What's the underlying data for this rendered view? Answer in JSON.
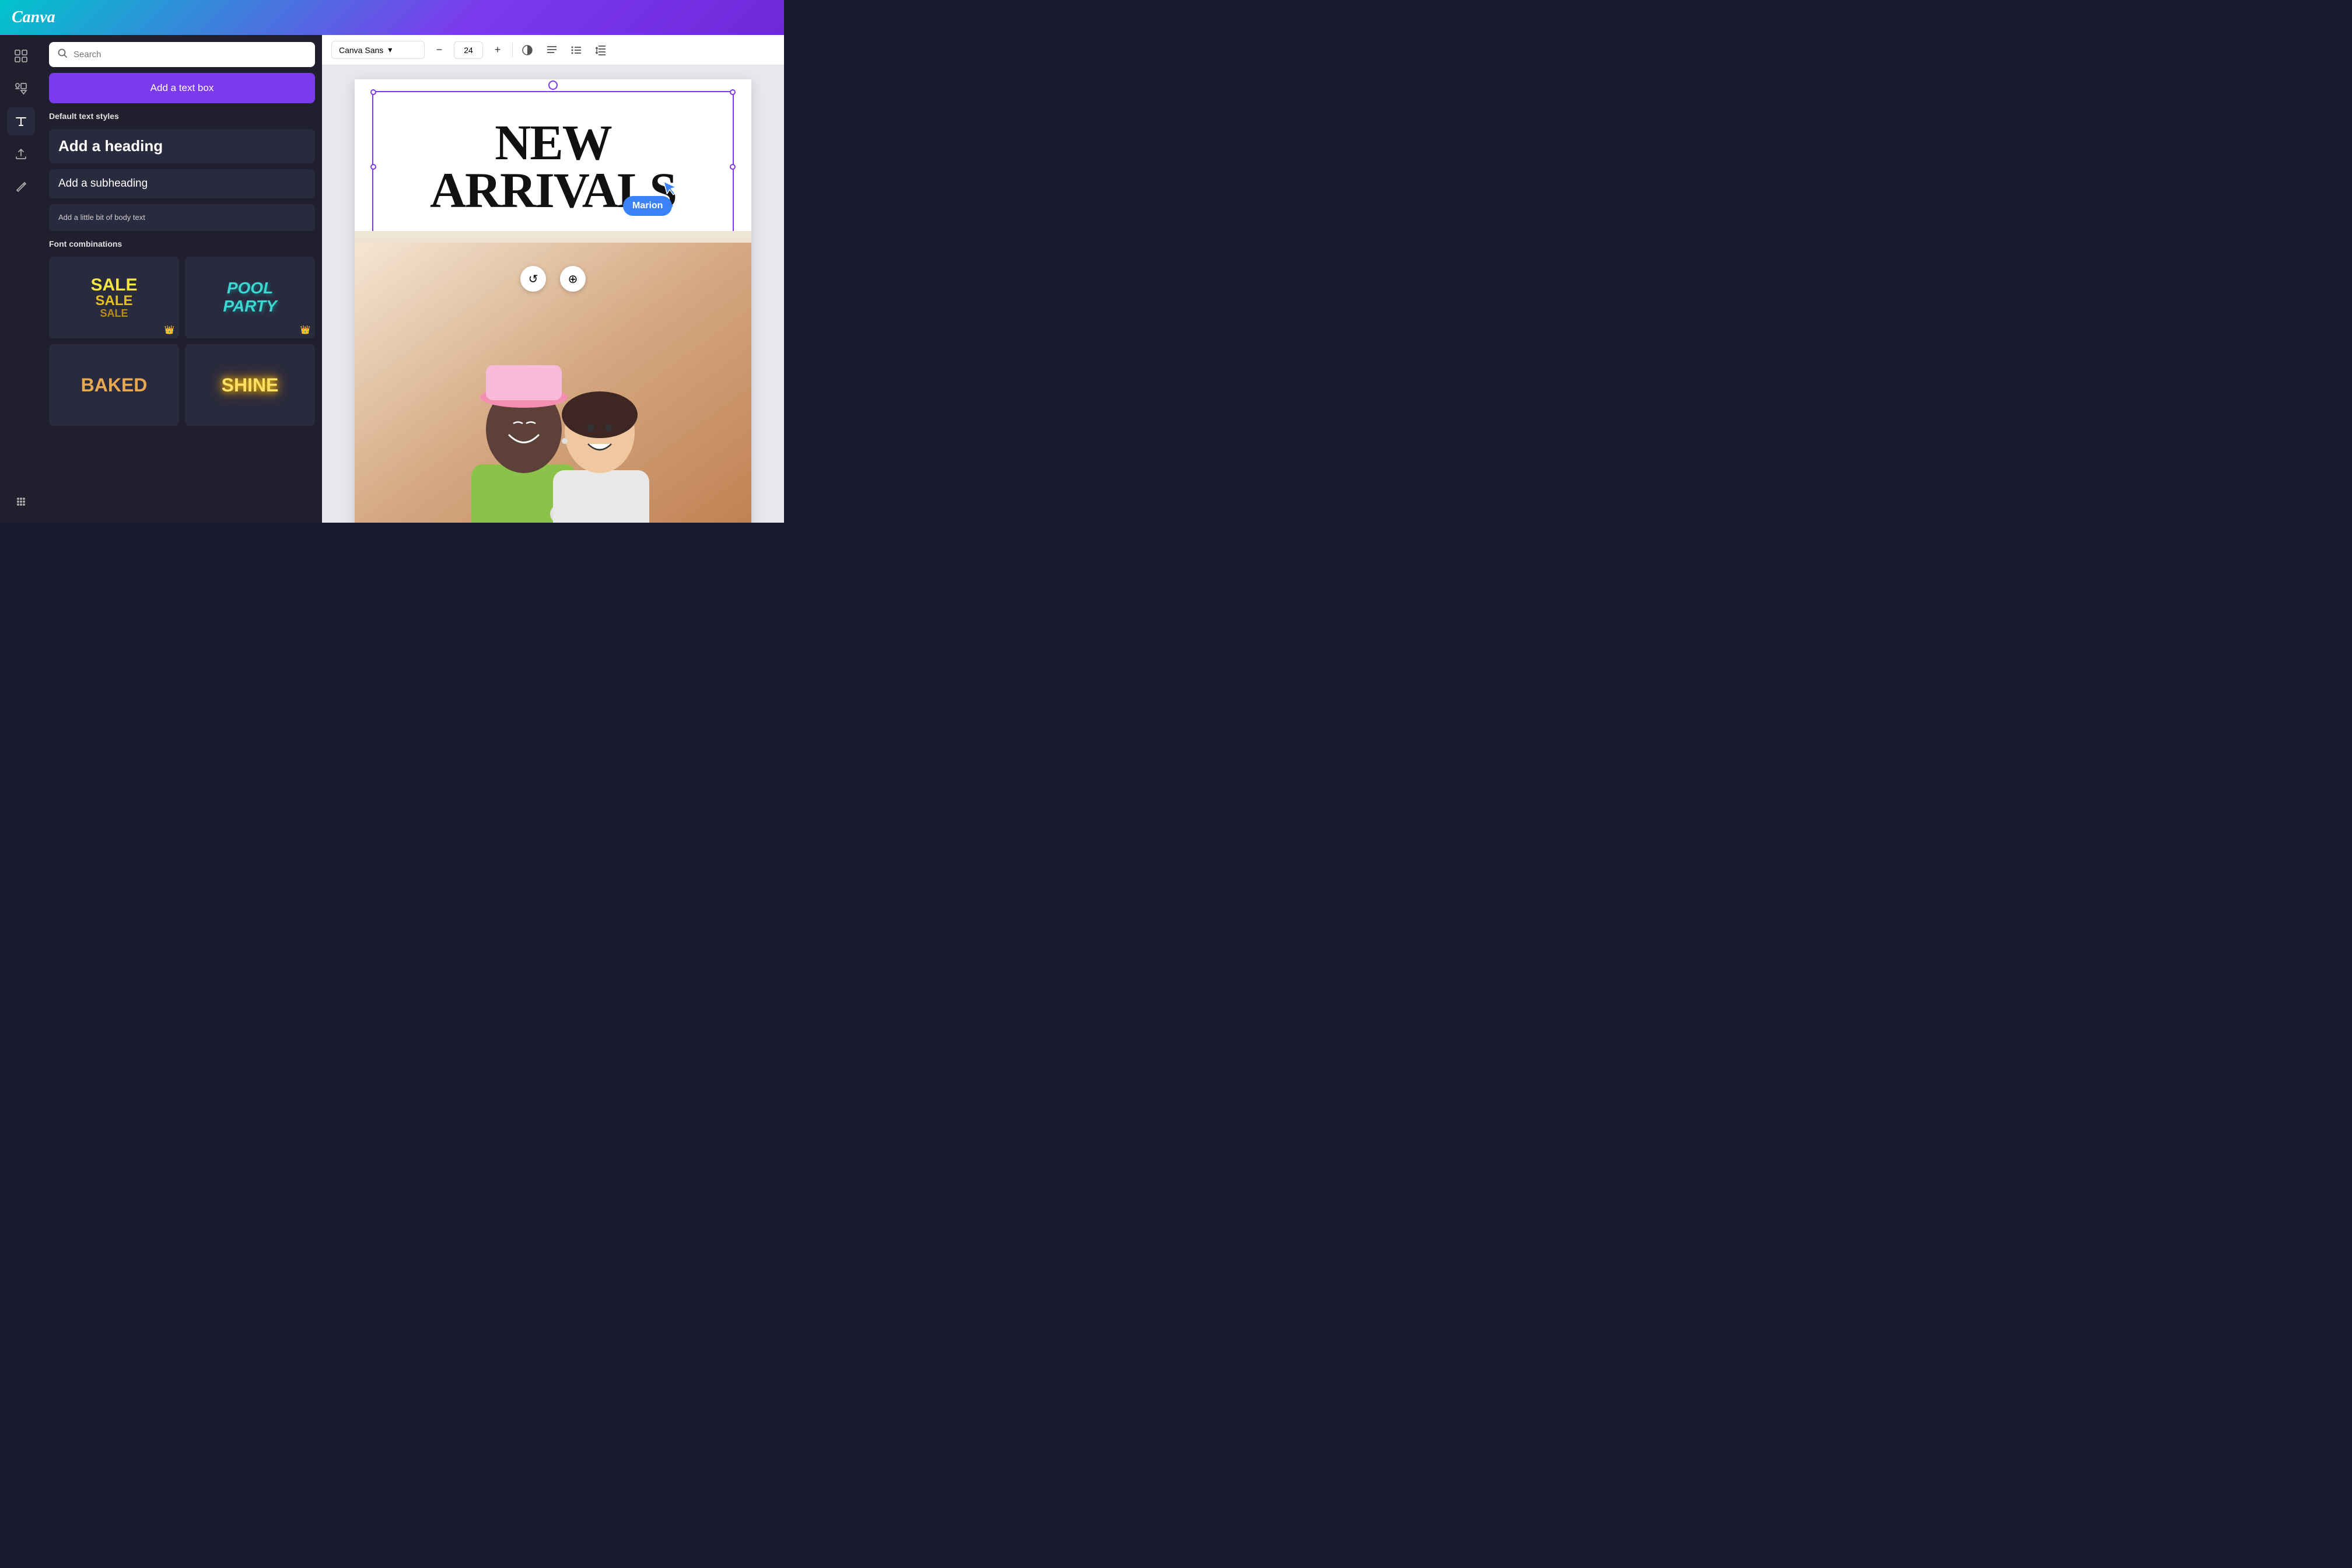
{
  "header": {
    "logo": "Canva"
  },
  "sidebar": {
    "icons": [
      {
        "name": "grid-icon",
        "symbol": "⊞",
        "active": false
      },
      {
        "name": "elements-icon",
        "symbol": "❤△",
        "active": false
      },
      {
        "name": "text-icon",
        "symbol": "T",
        "active": true
      },
      {
        "name": "upload-icon",
        "symbol": "⬆",
        "active": false
      },
      {
        "name": "draw-icon",
        "symbol": "✏",
        "active": false
      },
      {
        "name": "apps-icon",
        "symbol": "⋮⋮⋮",
        "active": false
      }
    ]
  },
  "text_panel": {
    "search_placeholder": "Search",
    "add_text_box_label": "Add a text box",
    "default_styles_label": "Default text styles",
    "heading_label": "Add a heading",
    "subheading_label": "Add a subheading",
    "body_label": "Add a little bit of body text",
    "font_combinations_label": "Font combinations",
    "combo1": {
      "lines": [
        "SALE",
        "SALE",
        "SALE"
      ],
      "has_crown": true
    },
    "combo2": {
      "lines": [
        "POOL",
        "PARTY"
      ],
      "has_crown": true
    },
    "combo3": {
      "label": "BAKED"
    },
    "combo4": {
      "label": "SHINE"
    }
  },
  "toolbar": {
    "font_name": "Canva Sans",
    "font_size": "24",
    "decrease_label": "−",
    "increase_label": "+",
    "align_left_label": "≡",
    "list_label": "≡",
    "spacing_label": "↕"
  },
  "canvas": {
    "text_content_line1": "NEW",
    "text_content_line2": "ARRIVALS",
    "tooltip_text": "Marion",
    "rotate_icon": "↺",
    "move_icon": "⊕"
  },
  "colors": {
    "brand_purple": "#7c3aed",
    "header_gradient_start": "#00c4cc",
    "header_gradient_end": "#6d28d9",
    "sale_yellow": "#f5e642",
    "pool_teal": "#3dd6d0",
    "tooltip_blue": "#3b82f6"
  }
}
